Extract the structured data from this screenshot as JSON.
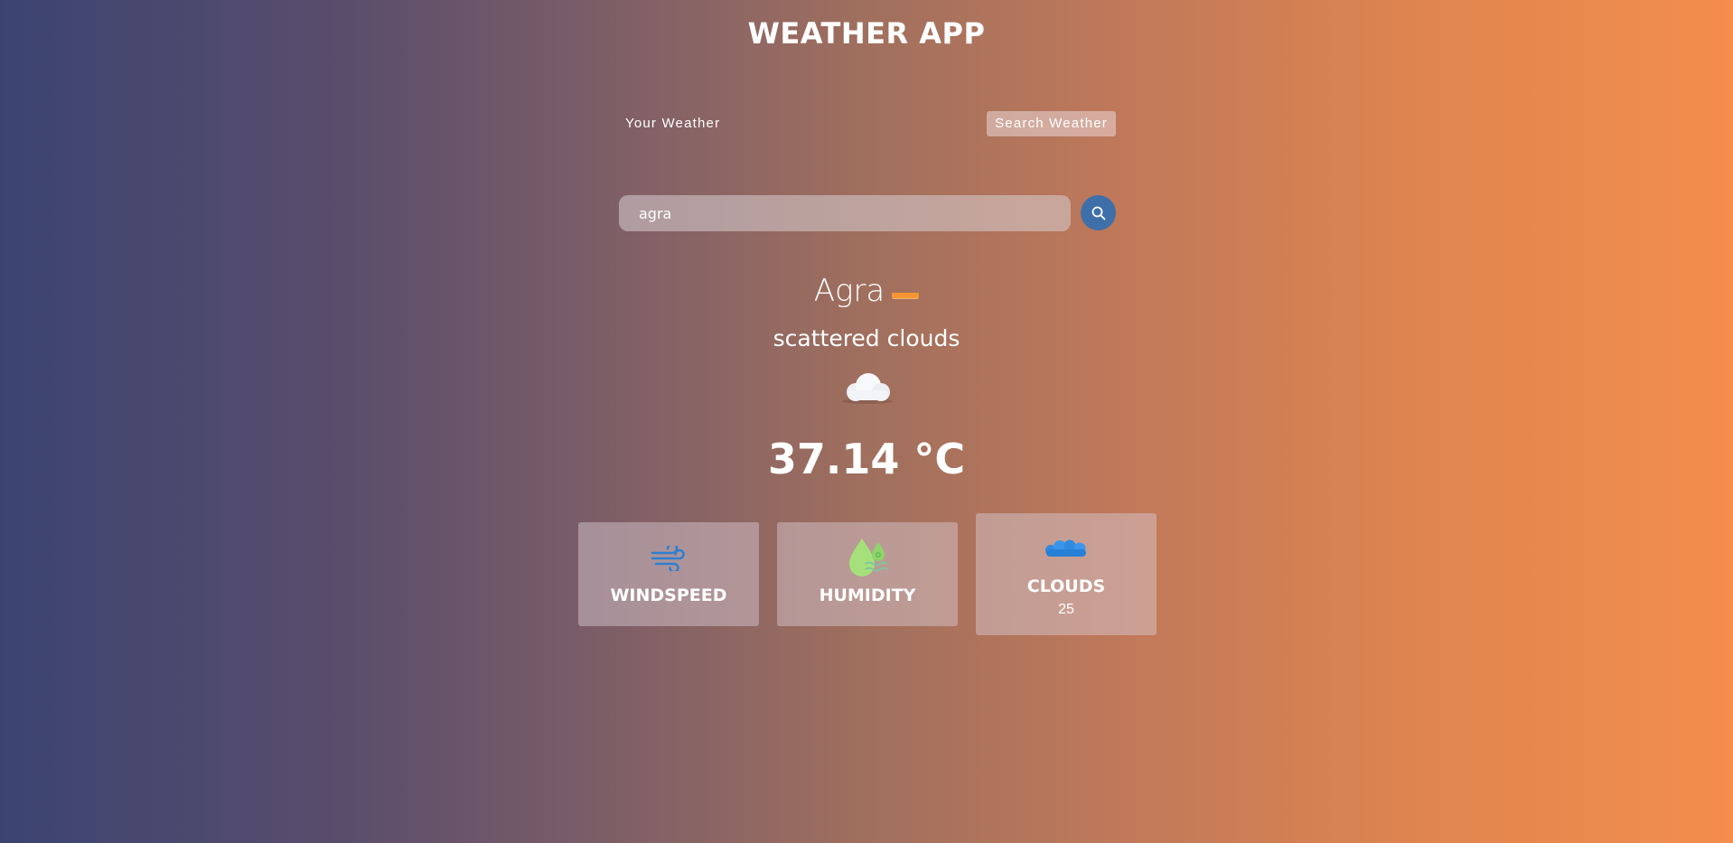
{
  "app": {
    "title": "WEATHER APP"
  },
  "tabs": [
    {
      "label": "Your Weather"
    },
    {
      "label": "Search Weather"
    }
  ],
  "search": {
    "value": "agra",
    "icon": "search-icon"
  },
  "weather": {
    "city": "Agra",
    "country_flag": "india-flag",
    "description": "scattered clouds",
    "condition_icon": "cloud-icon",
    "temperature": "37.14 °C"
  },
  "cards": [
    {
      "label": "WINDSPEED",
      "icon": "wind-icon",
      "value": ""
    },
    {
      "label": "HUMIDITY",
      "icon": "humidity-icon",
      "value": ""
    },
    {
      "label": "CLOUDS",
      "icon": "clouds-icon",
      "value": "25"
    }
  ],
  "colors": {
    "gradient_left": "#3b4471",
    "gradient_right": "#f48d4d",
    "search_button": "#3f6fa8",
    "wind_icon": "#2f7fd0",
    "humidity_icon": "#a6e07a",
    "clouds_icon": "#2e8be0"
  }
}
